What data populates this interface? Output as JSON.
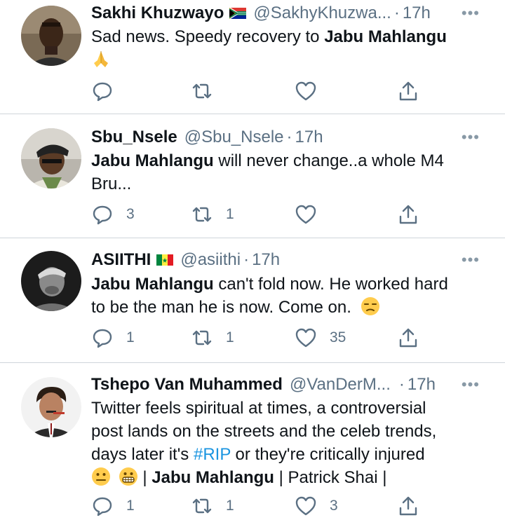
{
  "tweets": [
    {
      "name": "Sakhi Khuzwayo",
      "flag": "south-africa-flag",
      "handle": "@SakhyKhuzwa...",
      "time": "17h",
      "text_parts": [
        {
          "t": "Sad news. Speedy recovery to "
        },
        {
          "t": "Jabu Mahlangu",
          "bold": true
        }
      ],
      "text_line2_emoji": "folded-hands-emoji",
      "reply_count": "",
      "retweet_count": "",
      "like_count": ""
    },
    {
      "name": "Sbu_Nsele",
      "handle": "@Sbu_Nsele",
      "time": "17h",
      "line1_bold": "Jabu Mahlangu",
      "line1_rest": " will never change..a whole M4",
      "line2": "Bru...",
      "reply_count": "3",
      "retweet_count": "1",
      "like_count": ""
    },
    {
      "name": "ASIITHI",
      "flag": "senegal-flag",
      "handle": "@asiithi",
      "time": "17h",
      "line1_bold": "Jabu Mahlangu",
      "line1_rest": " can't fold now. He worked hard",
      "line2": "to be the man he is now. Come on.",
      "reply_count": "1",
      "retweet_count": "1",
      "like_count": "35"
    },
    {
      "name": "Tshepo Van Muhammed",
      "handle": "@VanDerM...",
      "time": "17h",
      "line1": "Twitter feels spiritual at times, a controversial",
      "line2": "post lands on the streets and the celeb trends,",
      "line3_pre": "days later it's ",
      "line3_tag": "#RIP",
      "line3_post": " or they're critically injured",
      "line4_sep1": " | ",
      "line4_bold": "Jabu Mahlangu",
      "line4_rest": " | Patrick Shai |",
      "reply_count": "1",
      "retweet_count": "1",
      "like_count": "3"
    }
  ],
  "ui": {
    "dot": "·",
    "more": "•••"
  },
  "colors": {
    "muted": "#5b7083",
    "link": "#1b95e0",
    "divider": "#cfd5da"
  }
}
